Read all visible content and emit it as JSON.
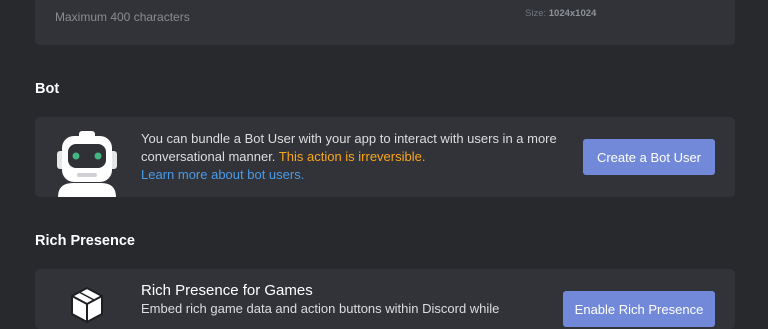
{
  "top": {
    "hint": "Maximum 400 characters",
    "size_label": "Size:",
    "size_value": "1024x1024"
  },
  "bot": {
    "heading": "Bot",
    "text_main": "You can bundle a Bot User with your app to interact with users in a more conversational manner.",
    "text_warning": "This action is irreversible.",
    "learn_more": "Learn more about bot users.",
    "button_label": "Create a Bot User",
    "robot_icon": "robot-icon"
  },
  "rich_presence": {
    "heading": "Rich Presence",
    "title": "Rich Presence for Games",
    "description": "Embed rich game data and action buttons within Discord while",
    "button_label": "Enable Rich Presence",
    "cube_icon": "cube-icon"
  },
  "colors": {
    "background": "#28292d",
    "panel": "#323338",
    "accent": "#7289da",
    "warning": "#faa61a",
    "link": "#4a9be8"
  }
}
